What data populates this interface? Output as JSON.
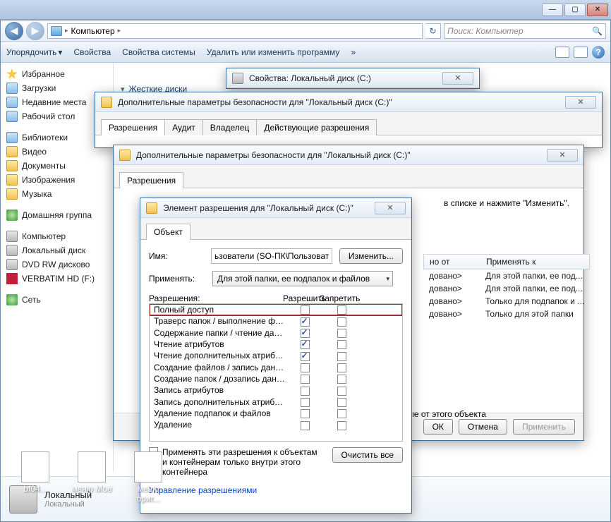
{
  "window": {
    "min": "—",
    "max": "▢",
    "close": "✕"
  },
  "nav": {
    "back": "◀",
    "fwd": "▶",
    "location": "Компьютер",
    "refresh": "↻",
    "search_placeholder": "Поиск: Компьютер",
    "search_icon": "🔍"
  },
  "toolbar": {
    "organize": "Упорядочить",
    "organize_arrow": "▾",
    "properties": "Свойства",
    "system_properties": "Свойства системы",
    "uninstall": "Удалить или изменить программу",
    "more": "»",
    "help": "?"
  },
  "sidebar": {
    "favorites": "Избранное",
    "downloads": "Загрузки",
    "recent": "Недавние места",
    "desktop": "Рабочий стол",
    "libraries": "Библиотеки",
    "video": "Видео",
    "documents": "Документы",
    "pictures": "Изображения",
    "music": "Музыка",
    "homegroup": "Домашняя группа",
    "computer": "Компьютер",
    "localdisk": "Локальный диск",
    "dvdrw": "DVD RW дисково",
    "verbatim": "VERBATIM HD (F:)",
    "network": "Сеть"
  },
  "content": {
    "hard_disks": "Жесткие диски",
    "arrow": "▾"
  },
  "details": {
    "title": "Локальный",
    "subtitle": "Локальный"
  },
  "desktop_icons": {
    "i1": "bf04...",
    "i2": "меню Мое",
    "i3": "меню ориг..."
  },
  "dlg_props": {
    "title": "Свойства: Локальный диск (C:)"
  },
  "dlg_sec1": {
    "title": "Дополнительные параметры безопасности  для \"Локальный диск (C:)\"",
    "tabs": {
      "perm": "Разрешения",
      "audit": "Аудит",
      "owner": "Владелец",
      "effective": "Действующие разрешения"
    }
  },
  "dlg_sec2": {
    "title": "Дополнительные параметры безопасности  для \"Локальный диск (C:)\"",
    "tab": "Разрешения",
    "hint_right": "в списке и нажмите \"Изменить\".",
    "table_header": {
      "inherited": "но от",
      "apply_to": "Применять к"
    },
    "rows": [
      {
        "inh": "довано>",
        "apply": "Для этой папки, ее под..."
      },
      {
        "inh": "довано>",
        "apply": "Для этой папки, ее под..."
      },
      {
        "inh": "довано>",
        "apply": "Только для подпапок и ..."
      },
      {
        "inh": "довано>",
        "apply": "Только для этой папки"
      }
    ],
    "inherit_text": "мые от этого объекта",
    "ok": "ОК",
    "cancel": "Отмена",
    "apply": "Применить"
  },
  "dlg_perm": {
    "title": "Элемент разрешения для \"Локальный диск (C:)\"",
    "tab": "Объект",
    "name_label": "Имя:",
    "name_value": "ьзователи (SO-ПК\\Пользователи)",
    "change": "Изменить...",
    "apply_label": "Применять:",
    "apply_value": "Для этой папки, ее подпапок и файлов",
    "perm_label": "Разрешения:",
    "col_allow": "Разрешить",
    "col_deny": "Запретить",
    "perms": [
      {
        "name": "Полный доступ",
        "allow": false,
        "deny": false,
        "hl": true
      },
      {
        "name": "Траверс папок / выполнение файлов",
        "allow": true,
        "deny": false
      },
      {
        "name": "Содержание папки / чтение данных",
        "allow": true,
        "deny": false
      },
      {
        "name": "Чтение атрибутов",
        "allow": true,
        "deny": false
      },
      {
        "name": "Чтение дополнительных атрибутов",
        "allow": true,
        "deny": false
      },
      {
        "name": "Создание файлов / запись данных",
        "allow": false,
        "deny": false
      },
      {
        "name": "Создание папок / дозапись данных",
        "allow": false,
        "deny": false
      },
      {
        "name": "Запись атрибутов",
        "allow": false,
        "deny": false
      },
      {
        "name": "Запись дополнительных атрибутов",
        "allow": false,
        "deny": false
      },
      {
        "name": "Удаление подпапок и файлов",
        "allow": false,
        "deny": false
      },
      {
        "name": "Удаление",
        "allow": false,
        "deny": false
      }
    ],
    "nested_chk": "Применять эти разрешения к объектам и контейнерам только внутри этого контейнера",
    "clear_all": "Очистить все",
    "manage_link": "Управление разрешениями"
  }
}
